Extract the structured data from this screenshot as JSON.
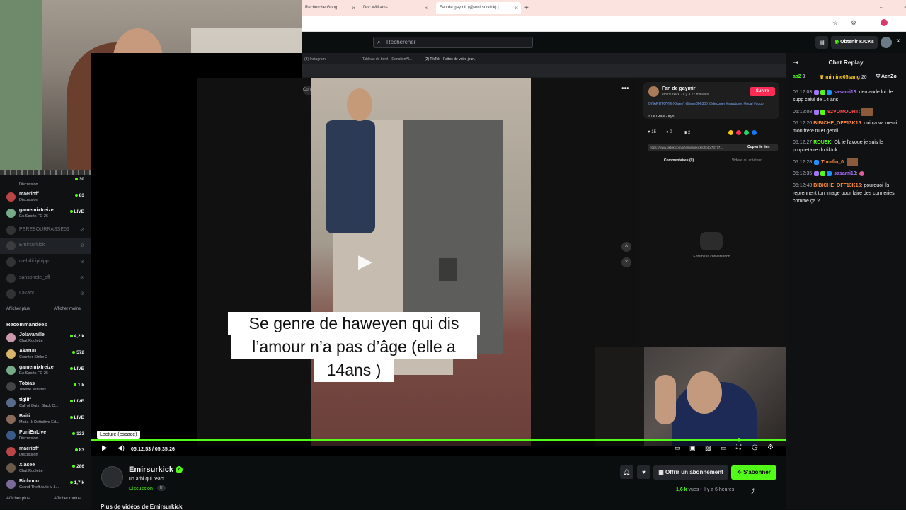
{
  "browser": {
    "tabs": [
      {
        "label": "Recherche Goog"
      },
      {
        "label": "Doc.Williams"
      },
      {
        "label": "Fan de gaymir (@emirsurkick) |"
      }
    ]
  },
  "topbar": {
    "search_placeholder": "Rechercher",
    "kicks_label": "Obtenir KICKs"
  },
  "sidebar": {
    "following": [
      {
        "name": "Discussion",
        "category": "",
        "viewers": "30",
        "live": true,
        "partial": true
      },
      {
        "name": "maerioff",
        "category": "Discussion",
        "viewers": "83",
        "live": true
      },
      {
        "name": "gamemixtreize",
        "category": "EA Sports FC 26",
        "viewers": "LIVE",
        "live": true
      },
      {
        "name": "PEREBOURRASSE69",
        "category": "",
        "viewers": "",
        "live": false
      },
      {
        "name": "Emirsurkick",
        "category": "",
        "viewers": "",
        "live": false
      },
      {
        "name": "mehdibipbipp",
        "category": "",
        "viewers": "",
        "live": false
      },
      {
        "name": "sansonete_off",
        "category": "",
        "viewers": "",
        "live": false
      },
      {
        "name": "Lakaht",
        "category": "",
        "viewers": "",
        "live": false
      }
    ],
    "show_more": "Afficher plus",
    "show_less": "Afficher moins",
    "recommended_title": "Recommandées",
    "recommended": [
      {
        "name": "Jolavanille",
        "category": "Chat Roulette",
        "viewers": "4,2 k"
      },
      {
        "name": "Akaruu",
        "category": "Counter-Strike 2",
        "viewers": "572"
      },
      {
        "name": "gamemixtreize",
        "category": "EA Sports FC 26",
        "viewers": "LIVE"
      },
      {
        "name": "Tobias",
        "category": "Twelve Minutes",
        "viewers": "1 k"
      },
      {
        "name": "tigiiif",
        "category": "Call of Duty: Black O...",
        "viewers": "LIVE"
      },
      {
        "name": "Baiti",
        "category": "Mafia II: Definitive Ed...",
        "viewers": "LIVE"
      },
      {
        "name": "PuniEnLive",
        "category": "Discussion",
        "viewers": "133"
      },
      {
        "name": "maerioff",
        "category": "Discussion",
        "viewers": "83"
      },
      {
        "name": "Xlasee",
        "category": "Chat Roulette",
        "viewers": "286"
      },
      {
        "name": "Bichouu",
        "category": "Grand Theft Auto V L...",
        "viewers": "1,7 k"
      }
    ],
    "show_more_2": "Afficher plus",
    "show_less_2": "Afficher moins"
  },
  "inner_browser": {
    "tabs": [
      "(3) Instagram",
      "Tableau de bord – DonationAl...",
      "(2) TikTok - Faites de votre jour..."
    ],
    "search_placeholder": "Contenu associé"
  },
  "tiktok": {
    "caption_line1": "Se genre de haweyen qui dis",
    "caption_line2": "l’amour n’a pas d’âge (elle a",
    "caption_line3": "14ans )",
    "author": "Fan de gaymir",
    "author_meta": "emirsurkick · Il y a 27 minutes",
    "follow_label": "Suivre",
    "description": "@NARUTOVIE (Owen) @emir006300 @decouer #narutovie #local #coup",
    "music": "Le Graal - Kyo",
    "likes": "15",
    "comments": "0",
    "saves": "2",
    "link": "https://www.tiktok.com/@emirsurkick/photo/74777...",
    "copy_link": "Copier le lien",
    "tab_comments": "Commentaires (0)",
    "tab_creator": "Vidéos du créateur",
    "empty_comments": "Entame la conversation"
  },
  "player": {
    "tooltip": "Lecture (espace)",
    "time_current": "05:12:53",
    "time_total": "05:35:26",
    "time_sep": "/",
    "progress_fraction": 0.933
  },
  "channel": {
    "name": "Emirsurkick",
    "title": "un arbi qui react",
    "category": "Discussion",
    "language": "fr",
    "offer_label": "Offrir un abonnement",
    "subscribe_label": "S'abonner",
    "views": "1,6 k",
    "views_suffix": "vues",
    "time_ago": "il y a 6 heures",
    "more_videos": "Plus de vidéos de Emirsurkick"
  },
  "chat": {
    "title": "Chat Replay",
    "top_gifters": [
      {
        "name": "aa2",
        "count": "9"
      },
      {
        "name": "mimine05sang",
        "count": "20"
      },
      {
        "name": "AenZo",
        "count": ""
      }
    ],
    "messages": [
      {
        "time": "05:12:03",
        "user": "sasami13",
        "color": "#a970ff",
        "text": "demande lui de supp celui de 14 ans"
      },
      {
        "time": "05:12:08",
        "user": "92VOMOORT",
        "color": "#ff4d4d",
        "text": ""
      },
      {
        "time": "05:12:20",
        "user": "BIBICHE_OFF13K15",
        "color": "#ff8c42",
        "text": "oui ça va merci mon frère tu et gentil"
      },
      {
        "time": "05:12:27",
        "user": "ROUEK",
        "color": "#53fc18",
        "text": "Ok je l'avoue je suis le proprietaire du tiktok"
      },
      {
        "time": "05:12:28",
        "user": "Thorfin_0",
        "color": "#ff8c42",
        "text": ""
      },
      {
        "time": "05:12:35",
        "user": "sasami13",
        "color": "#a970ff",
        "text": ""
      },
      {
        "time": "05:12:48",
        "user": "BIBICHE_OFF13K15",
        "color": "#ff8c42",
        "text": "pourquoi ils reprennent ton image pour faire des conneries comme ça ?"
      }
    ]
  },
  "colors": {
    "accent": "#53fc18",
    "background": "#0b0e0f",
    "tiktok_red": "#fe2c55"
  }
}
